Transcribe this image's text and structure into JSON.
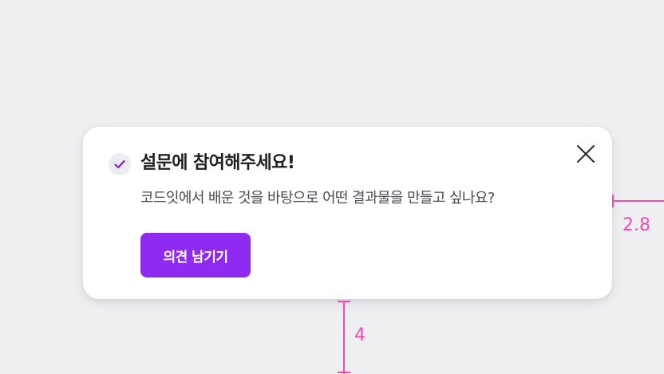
{
  "toast": {
    "title": "설문에 참여해주세요!",
    "message": "코드잇에서 배운 것을 바탕으로 어떤 결과물을 만들고 싶나요?",
    "button_label": "의견 남기기",
    "check_icon": "check-icon",
    "close_icon": "close-icon"
  },
  "spacing_guides": {
    "right_label": "2.8",
    "bottom_label": "4"
  },
  "colors": {
    "background": "#efeff2",
    "card": "#ffffff",
    "accent": "#8f2af2",
    "guide": "#f24bb4",
    "title_text": "#1f1f23",
    "body_text": "#4a4a52"
  }
}
